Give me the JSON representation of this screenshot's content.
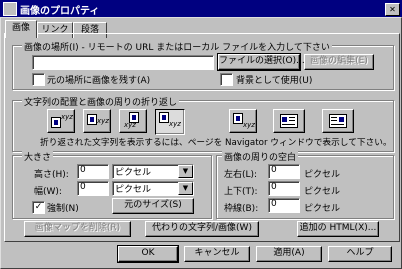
{
  "window": {
    "title": "画像のプロパティ"
  },
  "tabs": [
    {
      "label": "画像"
    },
    {
      "label": "リンク"
    },
    {
      "label": "段落"
    }
  ],
  "image_location": {
    "group_label": "画像の場所(I) - リモートの URL またはローカル ファイルを入力して下さい",
    "url_value": "",
    "choose_file_label": "ファイルの選択(O)...",
    "edit_image_label": "画像の編集(E)",
    "keep_original_label": "元の場所に画像を残す(A)",
    "keep_original_checked": false,
    "use_as_background_label": "背景として使用(U)",
    "use_as_background_checked": false
  },
  "alignment": {
    "group_label": "文字列の配置と画像の周りの折り返し",
    "options": [
      {
        "name": "align-top",
        "text": "xyz",
        "selected": false
      },
      {
        "name": "align-center",
        "text": "xyz",
        "selected": false
      },
      {
        "name": "align-center-baseline",
        "text": "xyz",
        "selected": false
      },
      {
        "name": "align-bottom",
        "text": "xyz",
        "selected": true
      },
      {
        "name": "align-bottom-baseline",
        "text": "xyz",
        "selected": false
      },
      {
        "name": "wrap-left",
        "text": "",
        "selected": false
      },
      {
        "name": "wrap-right",
        "text": "",
        "selected": false
      }
    ],
    "note": "折り返された文字列を表示するには、ページを Navigator ウィンドウで表示して下さい。"
  },
  "size": {
    "group_label": "大きさ",
    "height_label": "高さ(H):",
    "height_value": "0",
    "height_unit": "ピクセル",
    "width_label": "幅(W):",
    "width_value": "0",
    "width_unit": "ピクセル",
    "constrain_label": "強制(N)",
    "constrain_checked": true,
    "original_size_label": "元のサイズ(S)"
  },
  "spacing": {
    "group_label": "画像の周りの空白",
    "left_right_label": "左右(L):",
    "left_right_value": "0",
    "top_bottom_label": "上下(T):",
    "top_bottom_value": "0",
    "border_label": "枠線(B):",
    "border_value": "0",
    "unit": "ピクセル"
  },
  "bottom_row": {
    "remove_image_map_label": "画像マップを削除(R)",
    "alt_text_label": "代わりの文字列/画像(W)",
    "extra_html_label": "追加の HTML(X)..."
  },
  "dialog_buttons": {
    "ok": "OK",
    "cancel": "キャンセル",
    "apply": "適用(A)",
    "help": "ヘルプ"
  }
}
